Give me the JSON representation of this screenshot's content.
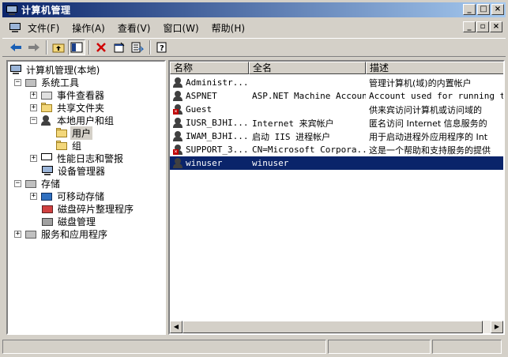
{
  "window": {
    "title": "计算机管理"
  },
  "menu": {
    "items": [
      "文件(F)",
      "操作(A)",
      "查看(V)",
      "窗口(W)",
      "帮助(H)"
    ]
  },
  "tree": {
    "root": "计算机管理(本地)",
    "system_tools": "系统工具",
    "event_viewer": "事件查看器",
    "shared_folders": "共享文件夹",
    "local_users_groups": "本地用户和组",
    "users": "用户",
    "groups": "组",
    "perf_logs": "性能日志和警报",
    "device_manager": "设备管理器",
    "storage": "存储",
    "removable_storage": "可移动存储",
    "disk_defrag": "磁盘碎片整理程序",
    "disk_mgmt": "磁盘管理",
    "services_apps": "服务和应用程序"
  },
  "list": {
    "columns": [
      "名称",
      "全名",
      "描述"
    ],
    "rows": [
      {
        "name": "Administr...",
        "fullname": "",
        "desc": "管理计算机(域)的内置帐户",
        "disabled": false,
        "selected": false
      },
      {
        "name": "ASPNET",
        "fullname": "ASP.NET Machine Account",
        "desc": "Account used for running the",
        "disabled": false,
        "selected": false
      },
      {
        "name": "Guest",
        "fullname": "",
        "desc": "供来宾访问计算机或访问域的",
        "disabled": true,
        "selected": false
      },
      {
        "name": "IUSR_BJHI...",
        "fullname": "Internet 来宾帐户",
        "desc": "匿名访问 Internet 信息服务的",
        "disabled": false,
        "selected": false
      },
      {
        "name": "IWAM_BJHI...",
        "fullname": "启动 IIS 进程帐户",
        "desc": "用于启动进程外应用程序的 Int",
        "disabled": false,
        "selected": false
      },
      {
        "name": "SUPPORT_3...",
        "fullname": "CN=Microsoft Corpora...",
        "desc": "这是一个帮助和支持服务的提供",
        "disabled": true,
        "selected": false
      },
      {
        "name": "winuser",
        "fullname": "winuser",
        "desc": "",
        "disabled": false,
        "selected": true
      }
    ]
  },
  "colors": {
    "title_start": "#0a246a",
    "title_end": "#a6caf0",
    "selection": "#0a246a",
    "face": "#d4d0c8"
  }
}
